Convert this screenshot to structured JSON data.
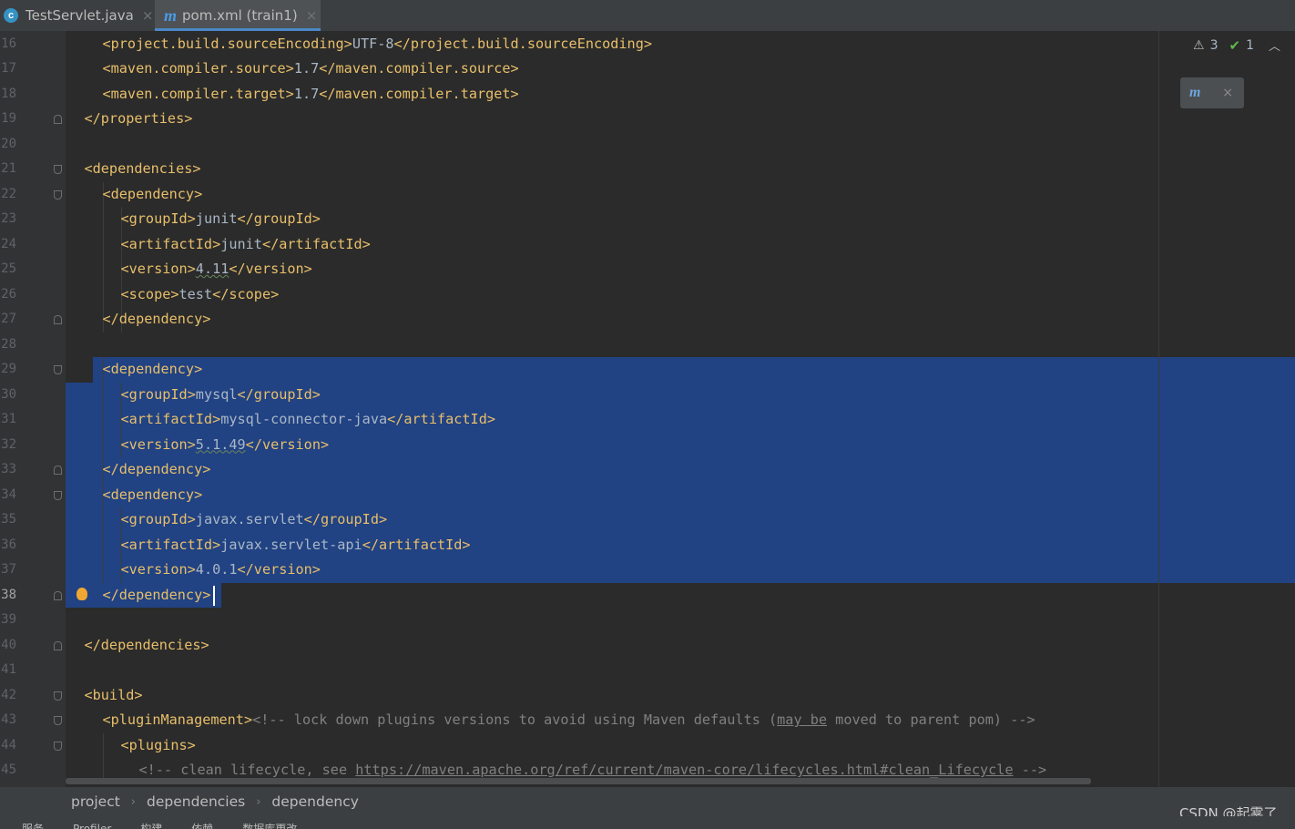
{
  "tabs": [
    {
      "label": "TestServlet.java",
      "icon": "java-class-icon",
      "active": false
    },
    {
      "label": "pom.xml (train1)",
      "icon": "maven-icon",
      "active": true
    }
  ],
  "tab_close_glyph": "×",
  "inspections": {
    "warnings": "3",
    "ok": "1"
  },
  "lines": [
    {
      "n": "16",
      "segs": [
        [
          "tg",
          "<project.build.sourceEncoding>"
        ],
        [
          "tx",
          "UTF-8"
        ],
        [
          "tg",
          "</project.build.sourceEncoding>"
        ]
      ],
      "indent": 2
    },
    {
      "n": "17",
      "segs": [
        [
          "tg",
          "<maven.compiler.source>"
        ],
        [
          "tx",
          "1.7"
        ],
        [
          "tg",
          "</maven.compiler.source>"
        ]
      ],
      "indent": 2
    },
    {
      "n": "18",
      "segs": [
        [
          "tg",
          "<maven.compiler.target>"
        ],
        [
          "tx",
          "1.7"
        ],
        [
          "tg",
          "</maven.compiler.target>"
        ]
      ],
      "indent": 2
    },
    {
      "n": "19",
      "segs": [
        [
          "tg",
          "</properties>"
        ]
      ],
      "indent": 1
    },
    {
      "n": "20",
      "segs": [],
      "indent": 0
    },
    {
      "n": "21",
      "segs": [
        [
          "tg",
          "<dependencies>"
        ]
      ],
      "indent": 1
    },
    {
      "n": "22",
      "segs": [
        [
          "tg",
          "<dependency>"
        ]
      ],
      "indent": 2
    },
    {
      "n": "23",
      "segs": [
        [
          "tg",
          "<groupId>"
        ],
        [
          "tx",
          "junit"
        ],
        [
          "tg",
          "</groupId>"
        ]
      ],
      "indent": 3
    },
    {
      "n": "24",
      "segs": [
        [
          "tg",
          "<artifactId>"
        ],
        [
          "tx",
          "junit"
        ],
        [
          "tg",
          "</artifactId>"
        ]
      ],
      "indent": 3
    },
    {
      "n": "25",
      "segs": [
        [
          "tg",
          "<version>"
        ],
        [
          "wv",
          "4.11"
        ],
        [
          "tg",
          "</version>"
        ]
      ],
      "indent": 3
    },
    {
      "n": "26",
      "segs": [
        [
          "tg",
          "<scope>"
        ],
        [
          "tx",
          "test"
        ],
        [
          "tg",
          "</scope>"
        ]
      ],
      "indent": 3
    },
    {
      "n": "27",
      "segs": [
        [
          "tg",
          "</dependency>"
        ]
      ],
      "indent": 2
    },
    {
      "n": "28",
      "segs": [],
      "indent": 0
    },
    {
      "n": "29",
      "segs": [
        [
          "tg",
          "<dependency>"
        ]
      ],
      "indent": 2
    },
    {
      "n": "30",
      "segs": [
        [
          "tg",
          "<groupId>"
        ],
        [
          "tx",
          "mysql"
        ],
        [
          "tg",
          "</groupId>"
        ]
      ],
      "indent": 3
    },
    {
      "n": "31",
      "segs": [
        [
          "tg",
          "<artifactId>"
        ],
        [
          "tx",
          "mysql-connector-java"
        ],
        [
          "tg",
          "</artifactId>"
        ]
      ],
      "indent": 3
    },
    {
      "n": "32",
      "segs": [
        [
          "tg",
          "<version>"
        ],
        [
          "wv",
          "5.1.49"
        ],
        [
          "tg",
          "</version>"
        ]
      ],
      "indent": 3
    },
    {
      "n": "33",
      "segs": [
        [
          "tg",
          "</dependency>"
        ]
      ],
      "indent": 2
    },
    {
      "n": "34",
      "segs": [
        [
          "tg",
          "<dependency>"
        ]
      ],
      "indent": 2
    },
    {
      "n": "35",
      "segs": [
        [
          "tg",
          "<groupId>"
        ],
        [
          "tx",
          "javax.servlet"
        ],
        [
          "tg",
          "</groupId>"
        ]
      ],
      "indent": 3
    },
    {
      "n": "36",
      "segs": [
        [
          "tg",
          "<artifactId>"
        ],
        [
          "tx",
          "javax.servlet-api"
        ],
        [
          "tg",
          "</artifactId>"
        ]
      ],
      "indent": 3
    },
    {
      "n": "37",
      "segs": [
        [
          "tg",
          "<version>"
        ],
        [
          "tx",
          "4.0.1"
        ],
        [
          "tg",
          "</version>"
        ]
      ],
      "indent": 3
    },
    {
      "n": "38",
      "segs": [
        [
          "tg",
          "</dependency>"
        ]
      ],
      "indent": 2
    },
    {
      "n": "39",
      "segs": [],
      "indent": 0
    },
    {
      "n": "40",
      "segs": [
        [
          "tg",
          "</dependencies>"
        ]
      ],
      "indent": 1
    },
    {
      "n": "41",
      "segs": [],
      "indent": 0
    },
    {
      "n": "42",
      "segs": [
        [
          "tg",
          "<build>"
        ]
      ],
      "indent": 1
    },
    {
      "n": "43",
      "segs": [
        [
          "tg",
          "<pluginManagement>"
        ],
        [
          "cm",
          "<!-- lock down plugins versions to avoid using Maven defaults ("
        ],
        [
          "cmu",
          "may be"
        ],
        [
          "cm",
          " moved to parent pom) -->"
        ]
      ],
      "indent": 2
    },
    {
      "n": "44",
      "segs": [
        [
          "tg",
          "<plugins>"
        ]
      ],
      "indent": 3
    },
    {
      "n": "45",
      "segs": [
        [
          "cm",
          "<!-- clean lifecycle, see "
        ],
        [
          "cmu",
          "https://maven.apache.org/ref/current/maven-core/lifecycles.html#clean_Lifecycle"
        ],
        [
          "cm",
          " -->"
        ]
      ],
      "indent": 4
    }
  ],
  "current_line": "38",
  "breadcrumb": [
    "project",
    "dependencies",
    "dependency"
  ],
  "breadcrumb_sep": "›",
  "watermark": "CSDN @起雾了_",
  "toolstrip": [
    "服务",
    "Profiler",
    "构建",
    "依赖",
    "数据库更改"
  ]
}
